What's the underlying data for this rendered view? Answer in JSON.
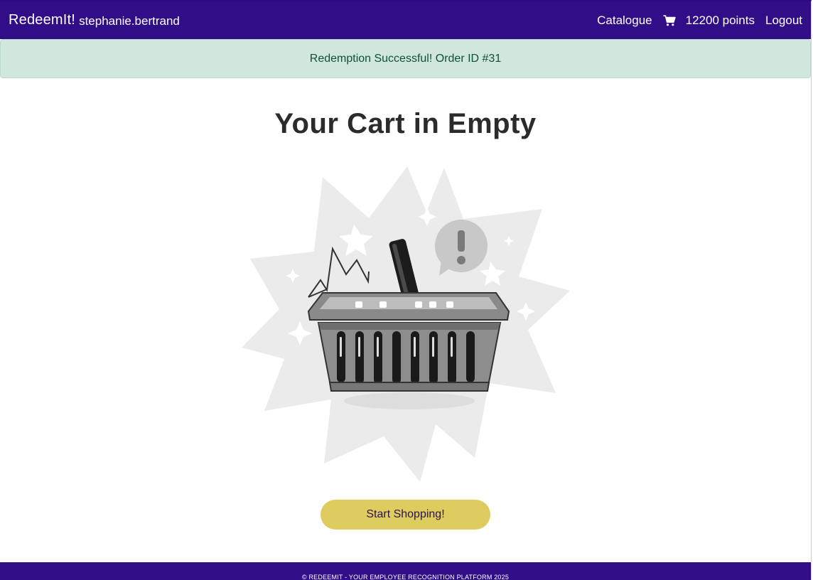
{
  "navbar": {
    "brand": "RedeemIt!",
    "username": "stephanie.bertrand",
    "catalogue_label": "Catalogue",
    "cart_icon": "cart-icon",
    "points_text": "12200 points",
    "logout_label": "Logout"
  },
  "alert": {
    "message": "Redemption Successful! Order ID #31"
  },
  "main": {
    "title": "Your Cart in Empty",
    "illustration_icon": "empty-basket-illustration",
    "cta_label": "Start Shopping!"
  },
  "footer": {
    "text": "© REDEEMIT - YOUR EMPLOYEE RECOGNITION PLATFORM 2025"
  },
  "colors": {
    "navbar_bg": "#310e87",
    "alert_bg": "#d1e7dd",
    "alert_text": "#0f5132",
    "cta_bg": "#dfcc5f",
    "footer_bg": "#310e87"
  }
}
